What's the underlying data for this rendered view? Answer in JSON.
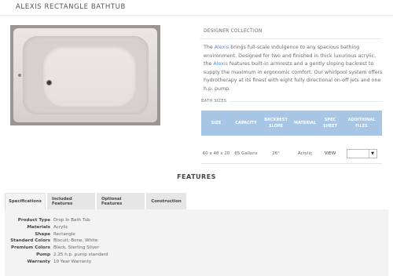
{
  "page": {
    "title": "ALEXIS RECTANGLE BATHTUB"
  },
  "product": {
    "image_alt": "Alexis rectangle bathtub",
    "collection": "DESIGNER COLLECTION",
    "description": {
      "p1": "The ",
      "h1": "Alexis",
      "p2": " brings full-scale indulgence to any spacious bathing environment. Designed for two and finished in thick luxurious acrylic, the ",
      "h2": "Alexis",
      "p3": " features built-in armrests and a gently sloping backrest to supply the maximum in ergonomic comfort. Our whirlpool system offers hydrotherapy at its finest with eight fully directional on-off jets and one h.p. pump."
    }
  },
  "bath_sizes": {
    "label": "BATH SIZES",
    "headers": [
      "SIZE",
      "CAPACITY",
      "BACKREST SLOPE",
      "MATERIAL",
      "SPEC SHEET",
      "ADDITIONAL FILES"
    ],
    "rows": [
      {
        "size": "60 x 48 x 20",
        "capacity": "65 Gallons",
        "slope": "26°",
        "material": "Acrylic",
        "spec": "VIEW",
        "files": ""
      }
    ]
  },
  "features": {
    "heading": "FEATURES",
    "tabs": [
      "Specifications",
      "Included Features",
      "Optional Features",
      "Construction"
    ],
    "active_tab": "Specifications",
    "specs": [
      {
        "key": "Product Type",
        "value": "Drop In Bath Tub"
      },
      {
        "key": "Materials",
        "value": "Acrylic"
      },
      {
        "key": "Shape",
        "value": "Rectangle"
      },
      {
        "key": "Standard Colors",
        "value": "Biscuit, Bone, White"
      },
      {
        "key": "Premium Colors",
        "value": "Black, Sterling Silver"
      },
      {
        "key": "Pump",
        "value": "2.25 h.p. pump standard"
      },
      {
        "key": "Warranty",
        "value": "10 Year Warranty"
      }
    ]
  },
  "colors": {
    "accent": "#a7c5e4",
    "link": "#5b8fd0",
    "panel": "#f3f3f3"
  }
}
